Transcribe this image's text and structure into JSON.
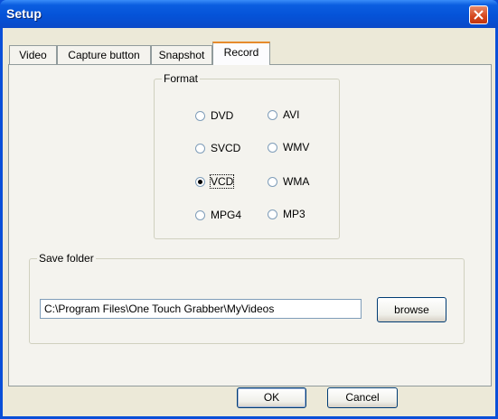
{
  "window": {
    "title": "Setup"
  },
  "tabs": [
    {
      "label": "Video",
      "active": false
    },
    {
      "label": "Capture button",
      "active": false
    },
    {
      "label": "Snapshot",
      "active": false
    },
    {
      "label": "Record",
      "active": true
    }
  ],
  "format_group": {
    "label": "Format",
    "options": [
      {
        "label": "DVD",
        "checked": false
      },
      {
        "label": "AVI",
        "checked": false
      },
      {
        "label": "SVCD",
        "checked": false
      },
      {
        "label": "WMV",
        "checked": false
      },
      {
        "label": "VCD",
        "checked": true
      },
      {
        "label": "WMA",
        "checked": false
      },
      {
        "label": "MPG4",
        "checked": false
      },
      {
        "label": "MP3",
        "checked": false
      }
    ]
  },
  "save_folder": {
    "label": "Save folder",
    "path": "C:\\Program Files\\One Touch Grabber\\MyVideos",
    "browse_label": "browse"
  },
  "buttons": {
    "ok": "OK",
    "cancel": "Cancel"
  },
  "icons": {
    "close": "close-icon"
  },
  "colors": {
    "titlebar": "#0553d8",
    "close": "#d4461c",
    "tab_highlight": "#e68b2c"
  }
}
